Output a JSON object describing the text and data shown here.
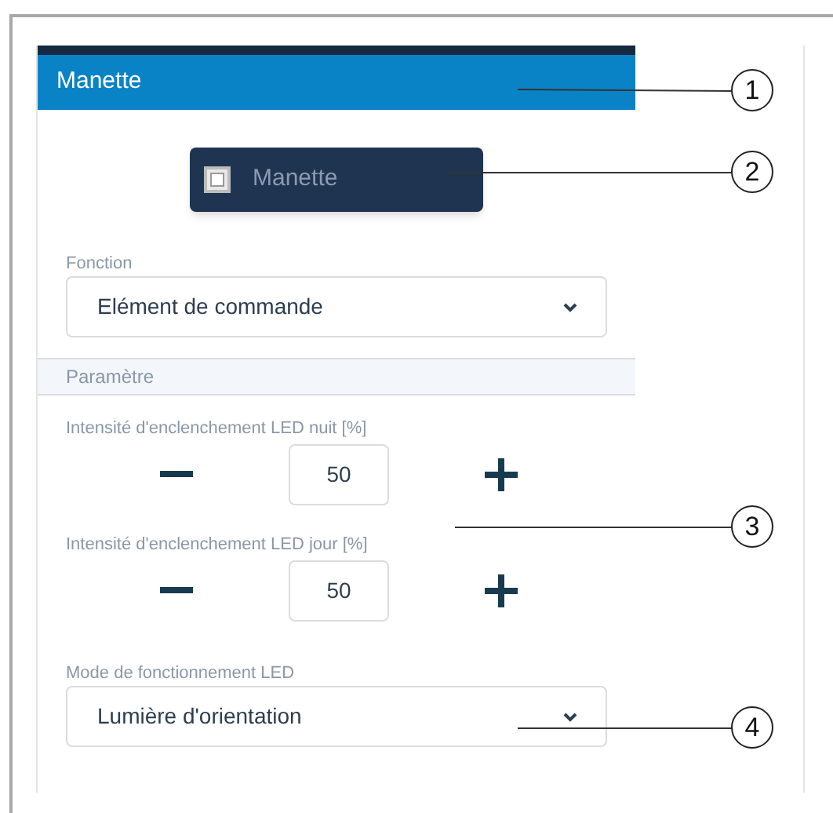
{
  "panel": {
    "title": "Manette"
  },
  "device_button": {
    "label": "Manette"
  },
  "function_field": {
    "label": "Fonction",
    "value": "Elément de commande"
  },
  "section": {
    "title": "Paramètre"
  },
  "steppers": [
    {
      "label": "Intensité d'enclenchement LED nuit [%]",
      "value": "50"
    },
    {
      "label": "Intensité d'enclenchement LED jour [%]",
      "value": "50"
    }
  ],
  "mode_field": {
    "label": "Mode de fonctionnement LED",
    "value": "Lumière d'orientation"
  },
  "callouts": [
    {
      "number": "1"
    },
    {
      "number": "2"
    },
    {
      "number": "3"
    },
    {
      "number": "4"
    }
  ]
}
